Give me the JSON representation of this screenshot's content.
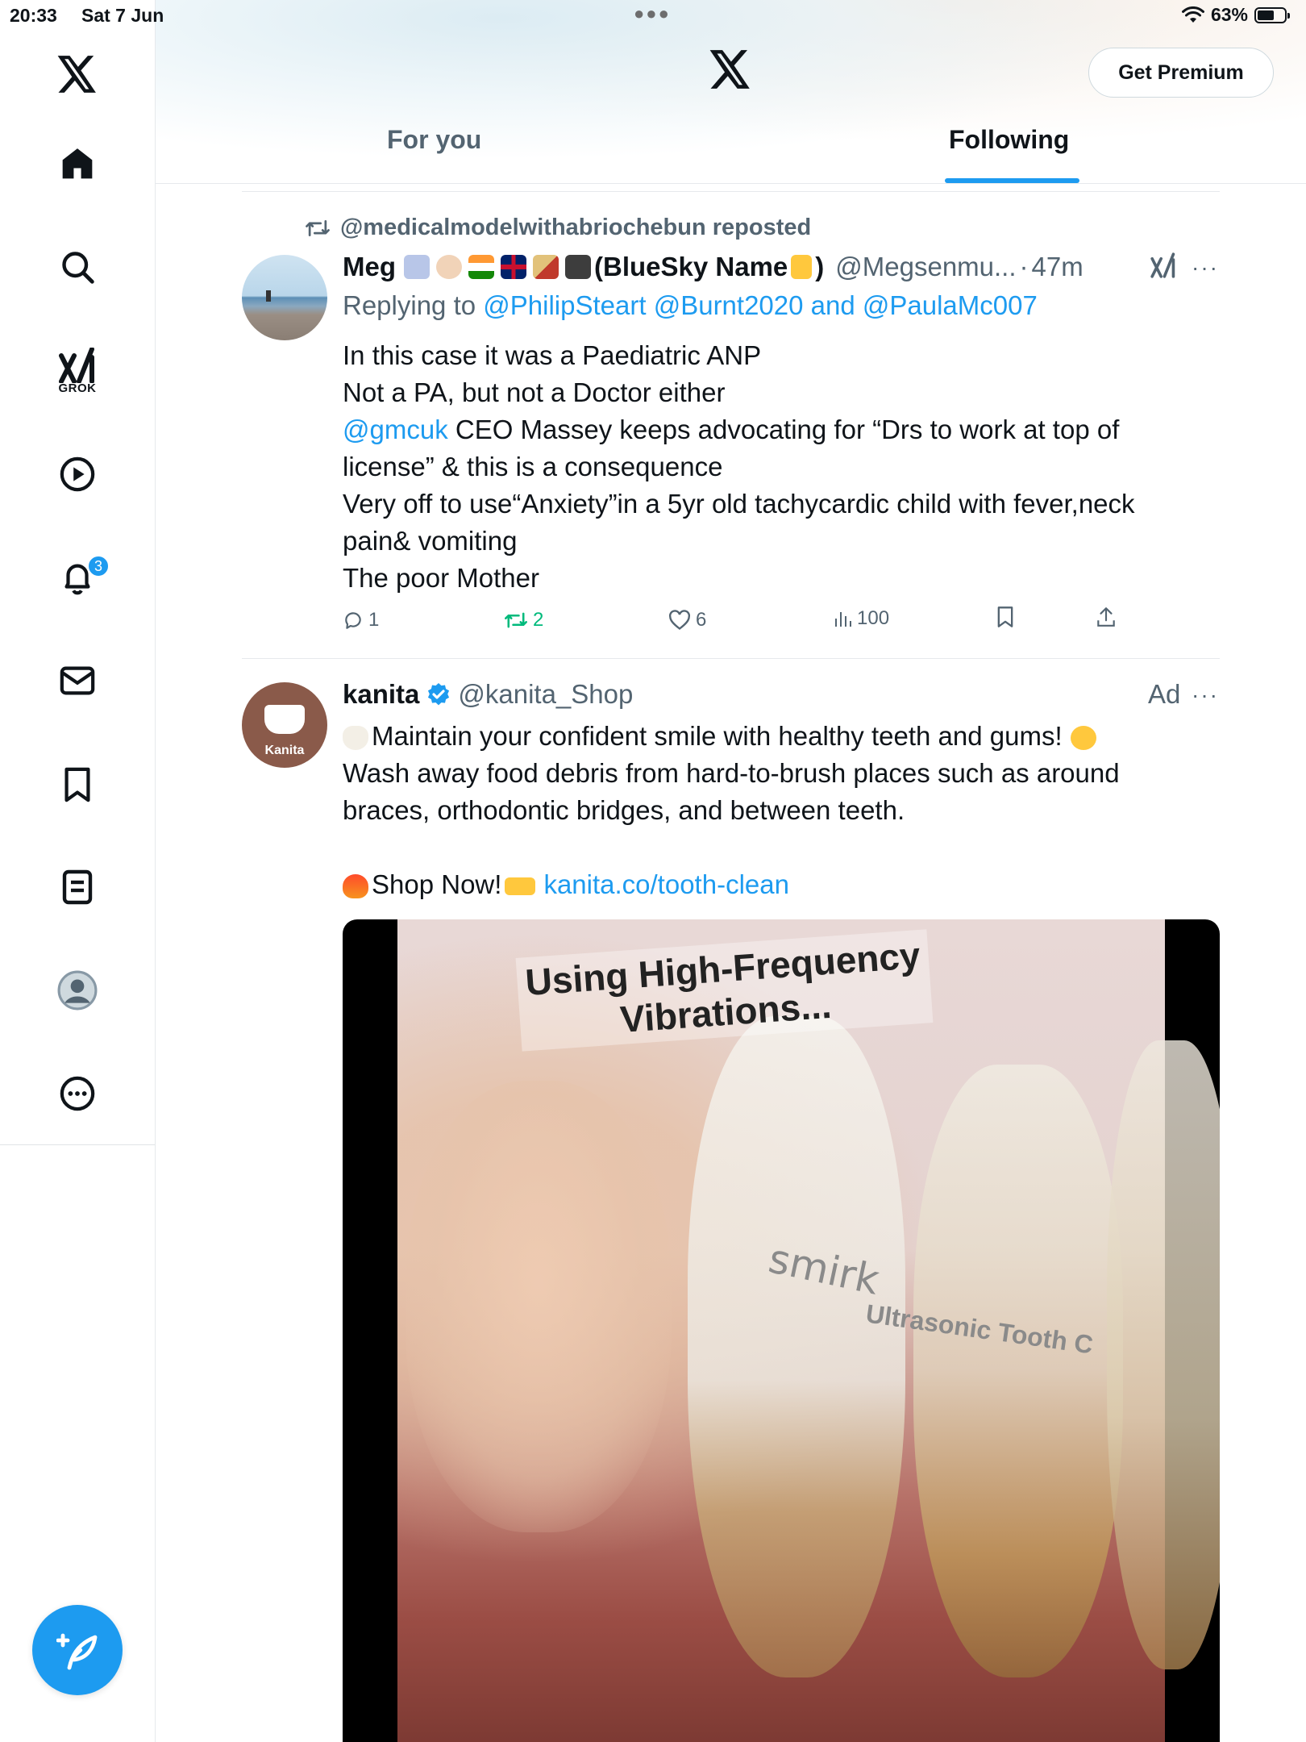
{
  "status_bar": {
    "time": "20:33",
    "date": "Sat 7 Jun",
    "battery": "63%",
    "battery_level": 0.63
  },
  "header": {
    "premium_label": "Get Premium",
    "tabs": [
      {
        "label": "For you",
        "active": false
      },
      {
        "label": "Following",
        "active": true
      }
    ]
  },
  "sidebar": {
    "items": [
      "x-logo",
      "home",
      "search",
      "grok",
      "video",
      "notifications",
      "messages",
      "bookmarks",
      "lists",
      "profile",
      "more"
    ],
    "grok_label": "GROK",
    "notifications_badge": "3"
  },
  "colors": {
    "accent": "#1d9bf0",
    "repost_green": "#00ba7c",
    "muted": "#536471",
    "text": "#0f1419"
  },
  "tweet1": {
    "repost_text": "@medicalmodelwithabriochebun reposted",
    "author_name_prefix": "Meg",
    "author_name_suffix": "(BlueSky Name",
    "author_name_end": ")",
    "handle_time": "@Megsenmu...",
    "time": "47m",
    "replying_label": "Replying to",
    "replying_to": "@PhilipSteart @Burnt2020 and @PaulaMc007",
    "lines": [
      "In this case it was a Paediatric ANP",
      "Not a PA, but not a Doctor either"
    ],
    "mention": "@gmcuk",
    "line3_rest": " CEO Massey keeps advocating for “Drs to work at top of",
    "lines_after": [
      "license” & this is a consequence",
      "Very off to use“Anxiety”in a 5yr old tachycardic child with fever,neck",
      "pain& vomiting",
      "The poor Mother"
    ],
    "replies": "1",
    "reposts": "2",
    "likes": "6",
    "views": "100"
  },
  "tweet2": {
    "author_name": "kanita",
    "handle": "@kanita_Shop",
    "ad_label": "Ad",
    "avatar_text": "Kanita",
    "line1": "Maintain your confident smile with healthy teeth and gums!",
    "line2": "Wash away food debris from hard-to-brush places such as around",
    "line3": "braces, orthodontic bridges, and between teeth.",
    "shop_text": "Shop Now!",
    "shop_link": "kanita.co/tooth-clean",
    "media_caption_1": "Using High-Frequency",
    "media_caption_2": "Vibrations...",
    "media_brand": "smirk",
    "media_product": "Ultrasonic Tooth C"
  }
}
